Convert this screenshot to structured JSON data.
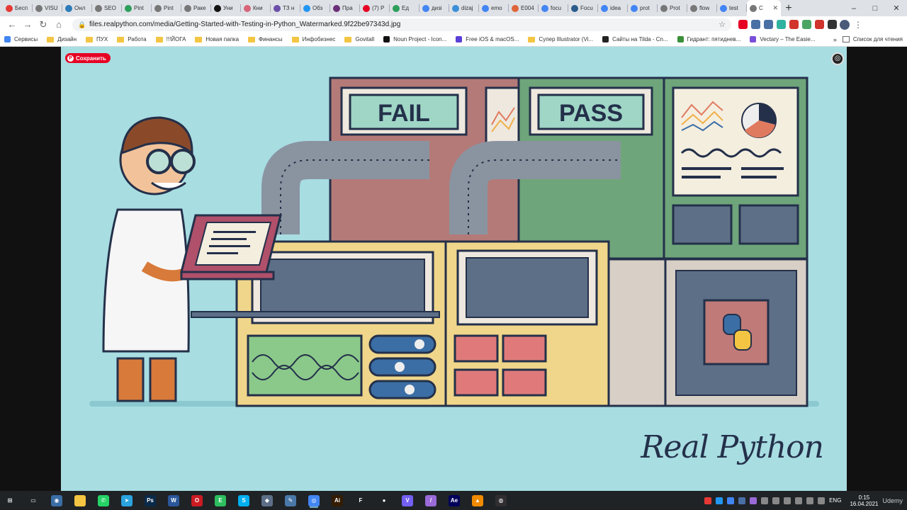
{
  "window": {
    "tabs": [
      {
        "label": "Бесп",
        "color": "#e53935"
      },
      {
        "label": "VISU",
        "color": "#777777"
      },
      {
        "label": "Онл",
        "color": "#2b7bb9"
      },
      {
        "label": "SEO",
        "color": "#777777"
      },
      {
        "label": "Pint",
        "color": "#2e9e5b"
      },
      {
        "label": "Pint",
        "color": "#777777"
      },
      {
        "label": "Раке",
        "color": "#777777"
      },
      {
        "label": "Уни",
        "color": "#111111"
      },
      {
        "label": "Кни",
        "color": "#d8647a"
      },
      {
        "label": "ТЗ н",
        "color": "#6b4fa8"
      },
      {
        "label": "Обз",
        "color": "#2196f3"
      },
      {
        "label": "Пра",
        "color": "#6b2f78"
      },
      {
        "label": "(7) P",
        "color": "#e60023"
      },
      {
        "label": "Ед",
        "color": "#2e9e5b"
      },
      {
        "label": "дизі",
        "color": "#4285f4"
      },
      {
        "label": "dizaj",
        "color": "#3a8fd8"
      },
      {
        "label": "еmo",
        "color": "#4285f4"
      },
      {
        "label": "E004",
        "color": "#e0643a"
      },
      {
        "label": "focu",
        "color": "#4285f4"
      },
      {
        "label": "Focu",
        "color": "#2b5c8a"
      },
      {
        "label": "idea",
        "color": "#4285f4"
      },
      {
        "label": "prot",
        "color": "#4285f4"
      },
      {
        "label": "Prot",
        "color": "#777777"
      },
      {
        "label": "flow",
        "color": "#777777"
      },
      {
        "label": "test",
        "color": "#4285f4"
      },
      {
        "label": "C",
        "color": "#777777",
        "active": true
      }
    ],
    "new_tab": "+",
    "minimize": "–",
    "maximize": "□",
    "close": "✕"
  },
  "toolbar": {
    "back": "←",
    "forward": "→",
    "reload": "↻",
    "home": "⌂",
    "url": "files.realpython.com/media/Getting-Started-with-Testing-in-Python_Watermarked.9f22be97343d.jpg",
    "star": "☆",
    "menu": "⋮",
    "extensions": [
      "#e60023",
      "#4a6fa5",
      "#4a6fa5",
      "#2fb3a0",
      "#d0342c",
      "#4aa564",
      "#d0342c",
      "#333333"
    ]
  },
  "bookmarks": {
    "items": [
      {
        "label": "Сервисы",
        "kind": "apps",
        "color": "#4285f4"
      },
      {
        "label": "Дизайн",
        "kind": "folder"
      },
      {
        "label": "ПУХ",
        "kind": "folder"
      },
      {
        "label": "Работа",
        "kind": "folder"
      },
      {
        "label": "!!!ЙОГА",
        "kind": "folder"
      },
      {
        "label": "Новая папка",
        "kind": "folder"
      },
      {
        "label": "Финансы",
        "kind": "folder"
      },
      {
        "label": "Инфобизнес",
        "kind": "folder"
      },
      {
        "label": "Govitall",
        "kind": "folder"
      },
      {
        "label": "Noun Project - Icon...",
        "kind": "site",
        "color": "#111111"
      },
      {
        "label": "Free iOS & macOS...",
        "kind": "site",
        "color": "#5a3fd8"
      },
      {
        "label": "Супер Illustrator (Vi...",
        "kind": "folder"
      },
      {
        "label": "Сайты на Tilda - Cn...",
        "kind": "site",
        "color": "#222222"
      },
      {
        "label": "Гидрант: пятиднев...",
        "kind": "site",
        "color": "#3a8f3a"
      },
      {
        "label": "Vectary – The Easie...",
        "kind": "site",
        "color": "#7a4fd8"
      }
    ],
    "more": "»",
    "reading_list": "Список для чтения"
  },
  "page": {
    "pin_save": "Сохранить",
    "fail_label": "FAIL",
    "pass_label": "PASS",
    "logo_text": "Real Python",
    "colors": {
      "background": "#a8dde2",
      "fail_panel": "#b47a78",
      "pass_panel": "#6ea57a",
      "console": "#f0d68a",
      "outline": "#24304a"
    }
  },
  "taskbar": {
    "apps": [
      {
        "name": "windows",
        "color": "#1f2326",
        "glyph": "⊞"
      },
      {
        "name": "task-view",
        "color": "#1f2326",
        "glyph": "▭"
      },
      {
        "name": "camera",
        "color": "#3a6ea5",
        "glyph": "◉"
      },
      {
        "name": "explorer",
        "color": "#f4c542",
        "glyph": ""
      },
      {
        "name": "whatsapp",
        "color": "#25d366",
        "glyph": "✆"
      },
      {
        "name": "telegram",
        "color": "#2aa3df",
        "glyph": "➤"
      },
      {
        "name": "photoshop",
        "color": "#0a2a4a",
        "glyph": "Ps"
      },
      {
        "name": "word",
        "color": "#2b579a",
        "glyph": "W"
      },
      {
        "name": "opera",
        "color": "#cc1b23",
        "glyph": "O"
      },
      {
        "name": "evernote",
        "color": "#2dbe60",
        "glyph": "E"
      },
      {
        "name": "skype",
        "color": "#00aff0",
        "glyph": "S"
      },
      {
        "name": "vpn",
        "color": "#5d6f87",
        "glyph": "◆"
      },
      {
        "name": "notes",
        "color": "#4a78a8",
        "glyph": "✎"
      },
      {
        "name": "chrome",
        "color": "#4285f4",
        "glyph": "◎",
        "active": true
      },
      {
        "name": "illustrator",
        "color": "#331c00",
        "glyph": "Ai"
      },
      {
        "name": "figma",
        "color": "#1f2326",
        "glyph": "F"
      },
      {
        "name": "record",
        "color": "#1f2326",
        "glyph": "●"
      },
      {
        "name": "viber",
        "color": "#7360f2",
        "glyph": "V"
      },
      {
        "name": "pen",
        "color": "#9a6ad8",
        "glyph": "/"
      },
      {
        "name": "after-effects",
        "color": "#00005b",
        "glyph": "Ae"
      },
      {
        "name": "vlc",
        "color": "#f08a00",
        "glyph": "▲"
      },
      {
        "name": "obs",
        "color": "#302e31",
        "glyph": "◍"
      }
    ],
    "tray_colors": [
      "#e53935",
      "#2196f3",
      "#4285f4",
      "#4a6fa5",
      "#9a6ad8",
      "#888888",
      "#888888",
      "#888888",
      "#888888",
      "#888888",
      "#888888"
    ],
    "lang": "ENG",
    "time": "0:15",
    "date": "16.04.2021",
    "watermark": "Udemy"
  }
}
